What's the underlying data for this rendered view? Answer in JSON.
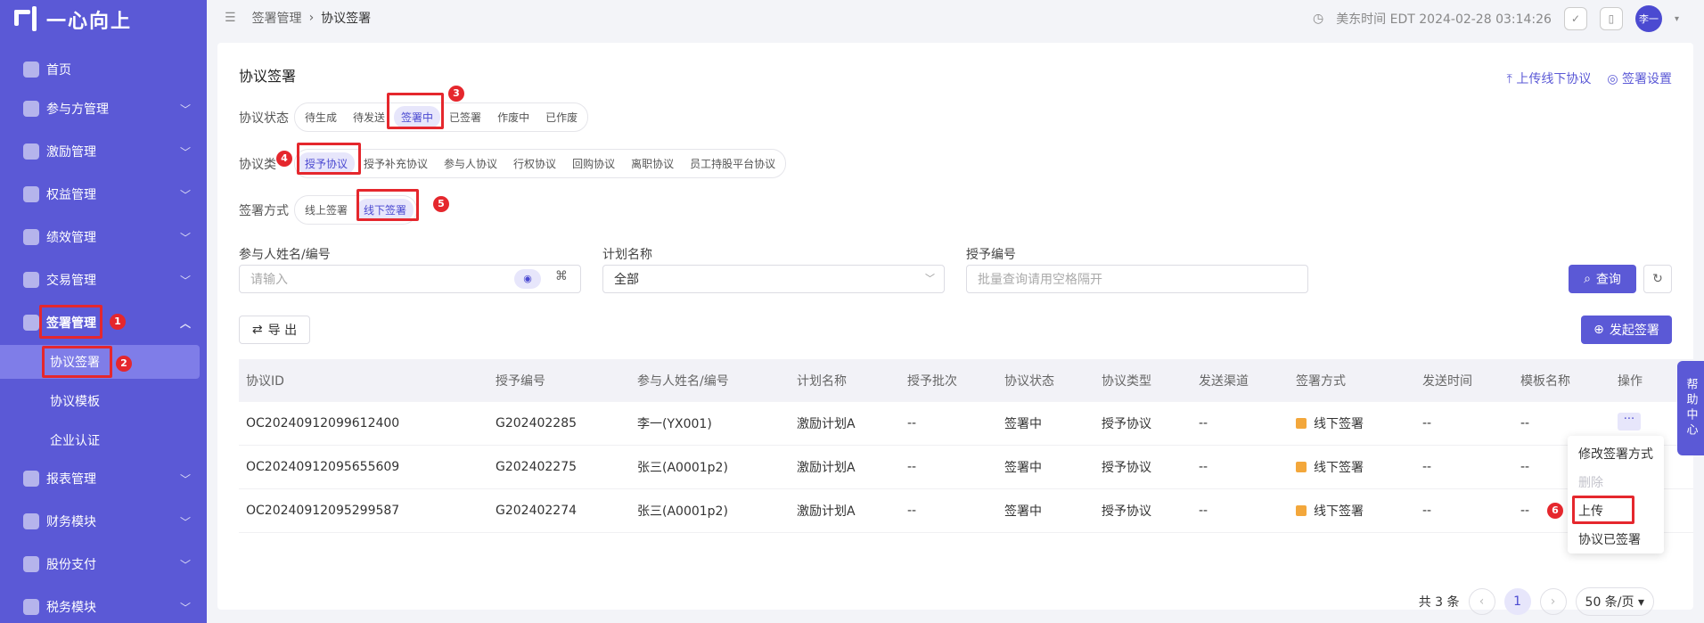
{
  "brand": {
    "name": "一心向上"
  },
  "sidebar": {
    "items": [
      {
        "label": "首页"
      },
      {
        "label": "参与方管理"
      },
      {
        "label": "激励管理"
      },
      {
        "label": "权益管理"
      },
      {
        "label": "绩效管理"
      },
      {
        "label": "交易管理"
      },
      {
        "label": "签署管理"
      },
      {
        "label": "报表管理"
      },
      {
        "label": "财务模块"
      },
      {
        "label": "股份支付"
      },
      {
        "label": "税务模块"
      }
    ],
    "sub_items": [
      {
        "label": "协议签署"
      },
      {
        "label": "协议模板"
      },
      {
        "label": "企业认证"
      }
    ]
  },
  "annotations": [
    "1",
    "2",
    "3",
    "4",
    "5",
    "6"
  ],
  "header": {
    "breadcrumb": [
      "签署管理",
      "协议签署"
    ],
    "time": "美东时间 EDT 2024-02-28 03:14:26",
    "avatar": "李一"
  },
  "page": {
    "title": "协议签署",
    "actions": {
      "upload_offline": "上传线下协议",
      "settings": "签署设置"
    }
  },
  "filters": {
    "status": {
      "label": "协议状态",
      "options": [
        "待生成",
        "待发送",
        "签署中",
        "已签署",
        "作废中",
        "已作废"
      ],
      "selected": 2
    },
    "type": {
      "label": "协议类",
      "options": [
        "授予协议",
        "授予补充协议",
        "参与人协议",
        "行权协议",
        "回购协议",
        "离职协议",
        "员工持股平台协议"
      ],
      "selected": 0
    },
    "method": {
      "label": "签署方式",
      "options": [
        "线上签署",
        "线下签署"
      ],
      "selected": 1
    }
  },
  "search": {
    "participant": {
      "label": "参与人姓名/编号",
      "placeholder": "请输入"
    },
    "plan": {
      "label": "计划名称",
      "value": "全部"
    },
    "grant": {
      "label": "授予编号",
      "placeholder": "批量查询请用空格隔开"
    },
    "query_label": "查询"
  },
  "toolbar": {
    "export_label": "导 出",
    "initiate_label": "发起签署"
  },
  "table": {
    "columns": [
      "协议ID",
      "授予编号",
      "参与人姓名/编号",
      "计划名称",
      "授予批次",
      "协议状态",
      "协议类型",
      "发送渠道",
      "签署方式",
      "发送时间",
      "模板名称",
      "操作"
    ],
    "rows": [
      [
        "OC20240912099612400",
        "G202402285",
        "李一(YX001)",
        "激励计划A",
        "--",
        "签署中",
        "授予协议",
        "--",
        "线下签署",
        "--",
        "--"
      ],
      [
        "OC20240912095655609",
        "G202402275",
        "张三(A0001p2)",
        "激励计划A",
        "--",
        "签署中",
        "授予协议",
        "--",
        "线下签署",
        "--",
        "--"
      ],
      [
        "OC20240912095299587",
        "G202402274",
        "张三(A0001p2)",
        "激励计划A",
        "--",
        "签署中",
        "授予协议",
        "--",
        "线下签署",
        "--",
        "--"
      ]
    ]
  },
  "row_menu": [
    "修改签署方式",
    "删除",
    "上传",
    "协议已签署"
  ],
  "pagination": {
    "total": "共 3 条",
    "current": "1",
    "page_size": "50 条/页"
  },
  "help": "帮助中心"
}
